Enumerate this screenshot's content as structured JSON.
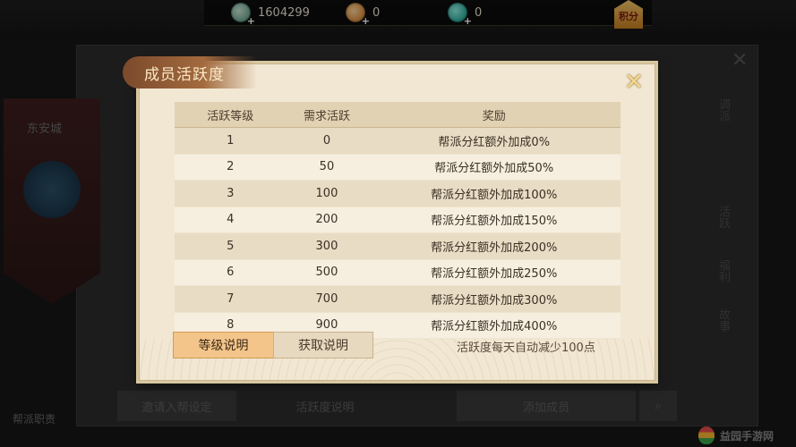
{
  "currency": {
    "jade_amount": "1604299",
    "gold_amount": "0",
    "teal_amount": "0",
    "score_label": "积分"
  },
  "background": {
    "banner_label": "东安城",
    "sidebar_items": [
      "调派",
      "活跃",
      "福利",
      "故事"
    ],
    "bottom_buttons": [
      "邀请入帮设定",
      "活跃度说明",
      "添加成员"
    ],
    "bottom_left": "帮派职责",
    "watermark": "益园手游网"
  },
  "modal": {
    "title": "成员活跃度",
    "close_label": "✕",
    "headers": [
      "活跃等级",
      "需求活跃",
      "奖励"
    ],
    "rows": [
      [
        "1",
        "0",
        "帮派分红额外加成0%"
      ],
      [
        "2",
        "50",
        "帮派分红额外加成50%"
      ],
      [
        "3",
        "100",
        "帮派分红额外加成100%"
      ],
      [
        "4",
        "200",
        "帮派分红额外加成150%"
      ],
      [
        "5",
        "300",
        "帮派分红额外加成200%"
      ],
      [
        "6",
        "500",
        "帮派分红额外加成250%"
      ],
      [
        "7",
        "700",
        "帮派分红额外加成300%"
      ],
      [
        "8",
        "900",
        "帮派分红额外加成400%"
      ]
    ],
    "tab_level": "等级说明",
    "tab_get": "获取说明",
    "note": "活跃度每天自动减少100点"
  },
  "colors": {
    "accent": "#f3c58a",
    "title_tab": "#a36a3e",
    "panel_bg": "#f1e7d3"
  }
}
